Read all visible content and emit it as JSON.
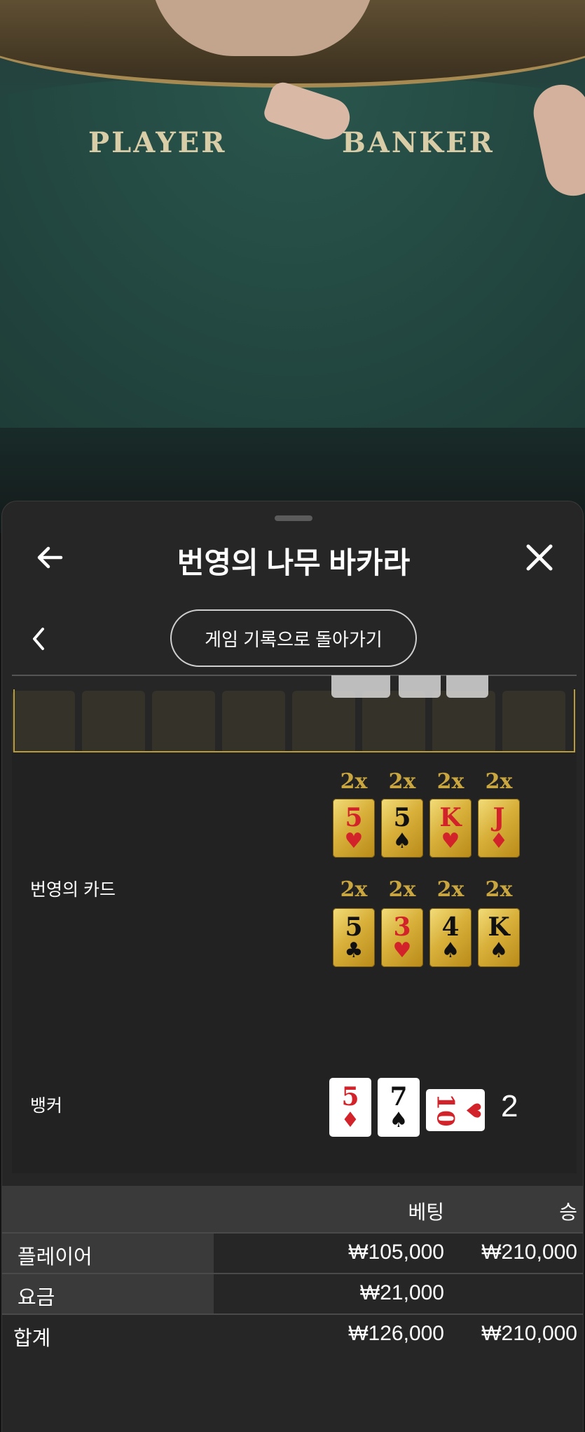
{
  "video": {
    "table_labels": [
      "PLAYER",
      "BANKER"
    ]
  },
  "sheet": {
    "title": "번영의 나무 바카라",
    "return_button": "게임 기록으로 돌아가기",
    "icons": {
      "back": "arrow-left-icon",
      "close": "close-icon",
      "prev": "chevron-left-icon"
    }
  },
  "lucky_cards": {
    "label": "번영의 카드",
    "rows": [
      [
        {
          "mult": "2x",
          "rank": "5",
          "suit": "♥",
          "color": "red"
        },
        {
          "mult": "2x",
          "rank": "5",
          "suit": "♠",
          "color": "black"
        },
        {
          "mult": "2x",
          "rank": "K",
          "suit": "♥",
          "color": "red"
        },
        {
          "mult": "2x",
          "rank": "J",
          "suit": "♦",
          "color": "red"
        }
      ],
      [
        {
          "mult": "2x",
          "rank": "5",
          "suit": "♣",
          "color": "black"
        },
        {
          "mult": "2x",
          "rank": "3",
          "suit": "♥",
          "color": "red"
        },
        {
          "mult": "2x",
          "rank": "4",
          "suit": "♠",
          "color": "black"
        },
        {
          "mult": "2x",
          "rank": "K",
          "suit": "♠",
          "color": "black"
        }
      ]
    ]
  },
  "banker": {
    "label": "뱅커",
    "cards": [
      {
        "rank": "5",
        "suit": "♦",
        "color": "red"
      },
      {
        "rank": "7",
        "suit": "♠",
        "color": "black"
      },
      {
        "rank": "10",
        "suit": "♥",
        "color": "red"
      }
    ],
    "score": "2"
  },
  "summary": {
    "headers": {
      "bet": "베팅",
      "win": "승"
    },
    "rows": [
      {
        "label": "플레이어",
        "bet": "₩105,000",
        "win": "₩210,000"
      },
      {
        "label": "요금",
        "bet": "₩21,000",
        "win": ""
      }
    ],
    "total": {
      "label": "합계",
      "bet": "₩126,000",
      "win": "₩210,000"
    }
  },
  "colors": {
    "accent_gold": "#c9a640",
    "sheet_bg": "#262626",
    "card_red": "#d2232a"
  }
}
